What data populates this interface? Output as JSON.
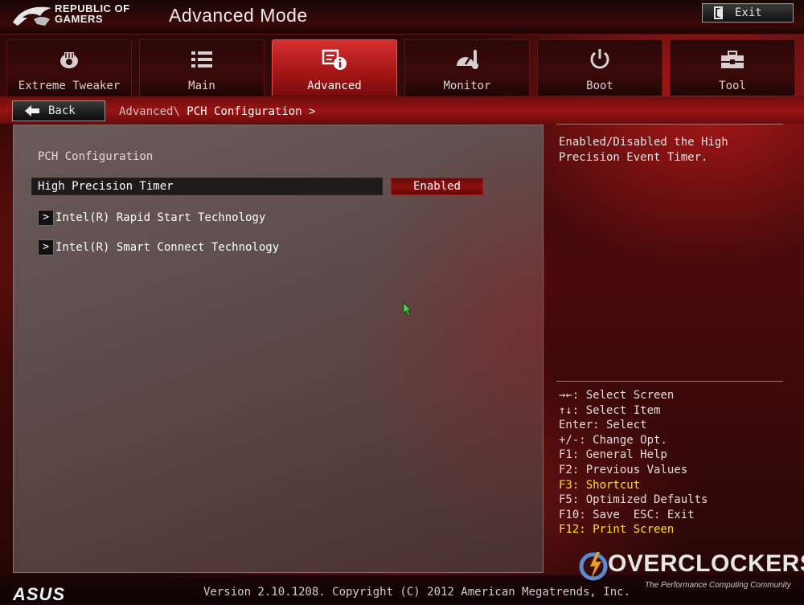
{
  "header": {
    "brand_line1": "REPUBLIC OF",
    "brand_line2": "GAMERS",
    "mode_title": "Advanced Mode",
    "exit_label": "Exit"
  },
  "tabs": [
    {
      "label": "Extreme Tweaker",
      "icon": "chip-icon",
      "active": false
    },
    {
      "label": "Main",
      "icon": "list-icon",
      "active": false
    },
    {
      "label": "Advanced",
      "icon": "settings-info-icon",
      "active": true
    },
    {
      "label": "Monitor",
      "icon": "gauge-icon",
      "active": false
    },
    {
      "label": "Boot",
      "icon": "power-icon",
      "active": false
    },
    {
      "label": "Tool",
      "icon": "toolbox-icon",
      "active": false
    }
  ],
  "breadcrumb": {
    "back_label": "Back",
    "parent": "Advanced\\",
    "current": "PCH Configuration >"
  },
  "main": {
    "section_title": "PCH Configuration",
    "option": {
      "label": "High Precision Timer",
      "value": "Enabled"
    },
    "submenus": [
      {
        "label": "Intel(R) Rapid Start Technology"
      },
      {
        "label": "Intel(R) Smart Connect Technology"
      }
    ]
  },
  "help_text": "Enabled/Disabled the High Precision Event Timer.",
  "key_legend": [
    {
      "text": "→←: Select Screen",
      "highlight": false
    },
    {
      "text": "↑↓: Select Item",
      "highlight": false
    },
    {
      "text": "Enter: Select",
      "highlight": false
    },
    {
      "text": "+/-: Change Opt.",
      "highlight": false
    },
    {
      "text": "F1: General Help",
      "highlight": false
    },
    {
      "text": "F2: Previous Values",
      "highlight": false
    },
    {
      "text": "F3: Shortcut",
      "highlight": true
    },
    {
      "text": "F5: Optimized Defaults",
      "highlight": false
    },
    {
      "text": "F10: Save  ESC: Exit",
      "highlight": false
    },
    {
      "text": "F12: Print Screen",
      "highlight": true
    }
  ],
  "footer": {
    "brand": "ASUS",
    "version": "Version 2.10.1208. Copyright (C) 2012 American Megatrends, Inc.",
    "watermark": "OVERCLOCKERS",
    "watermark_tagline": "The Performance Computing Community"
  },
  "colors": {
    "accent_red": "#a81616",
    "highlight_yellow": "#ffe020"
  }
}
